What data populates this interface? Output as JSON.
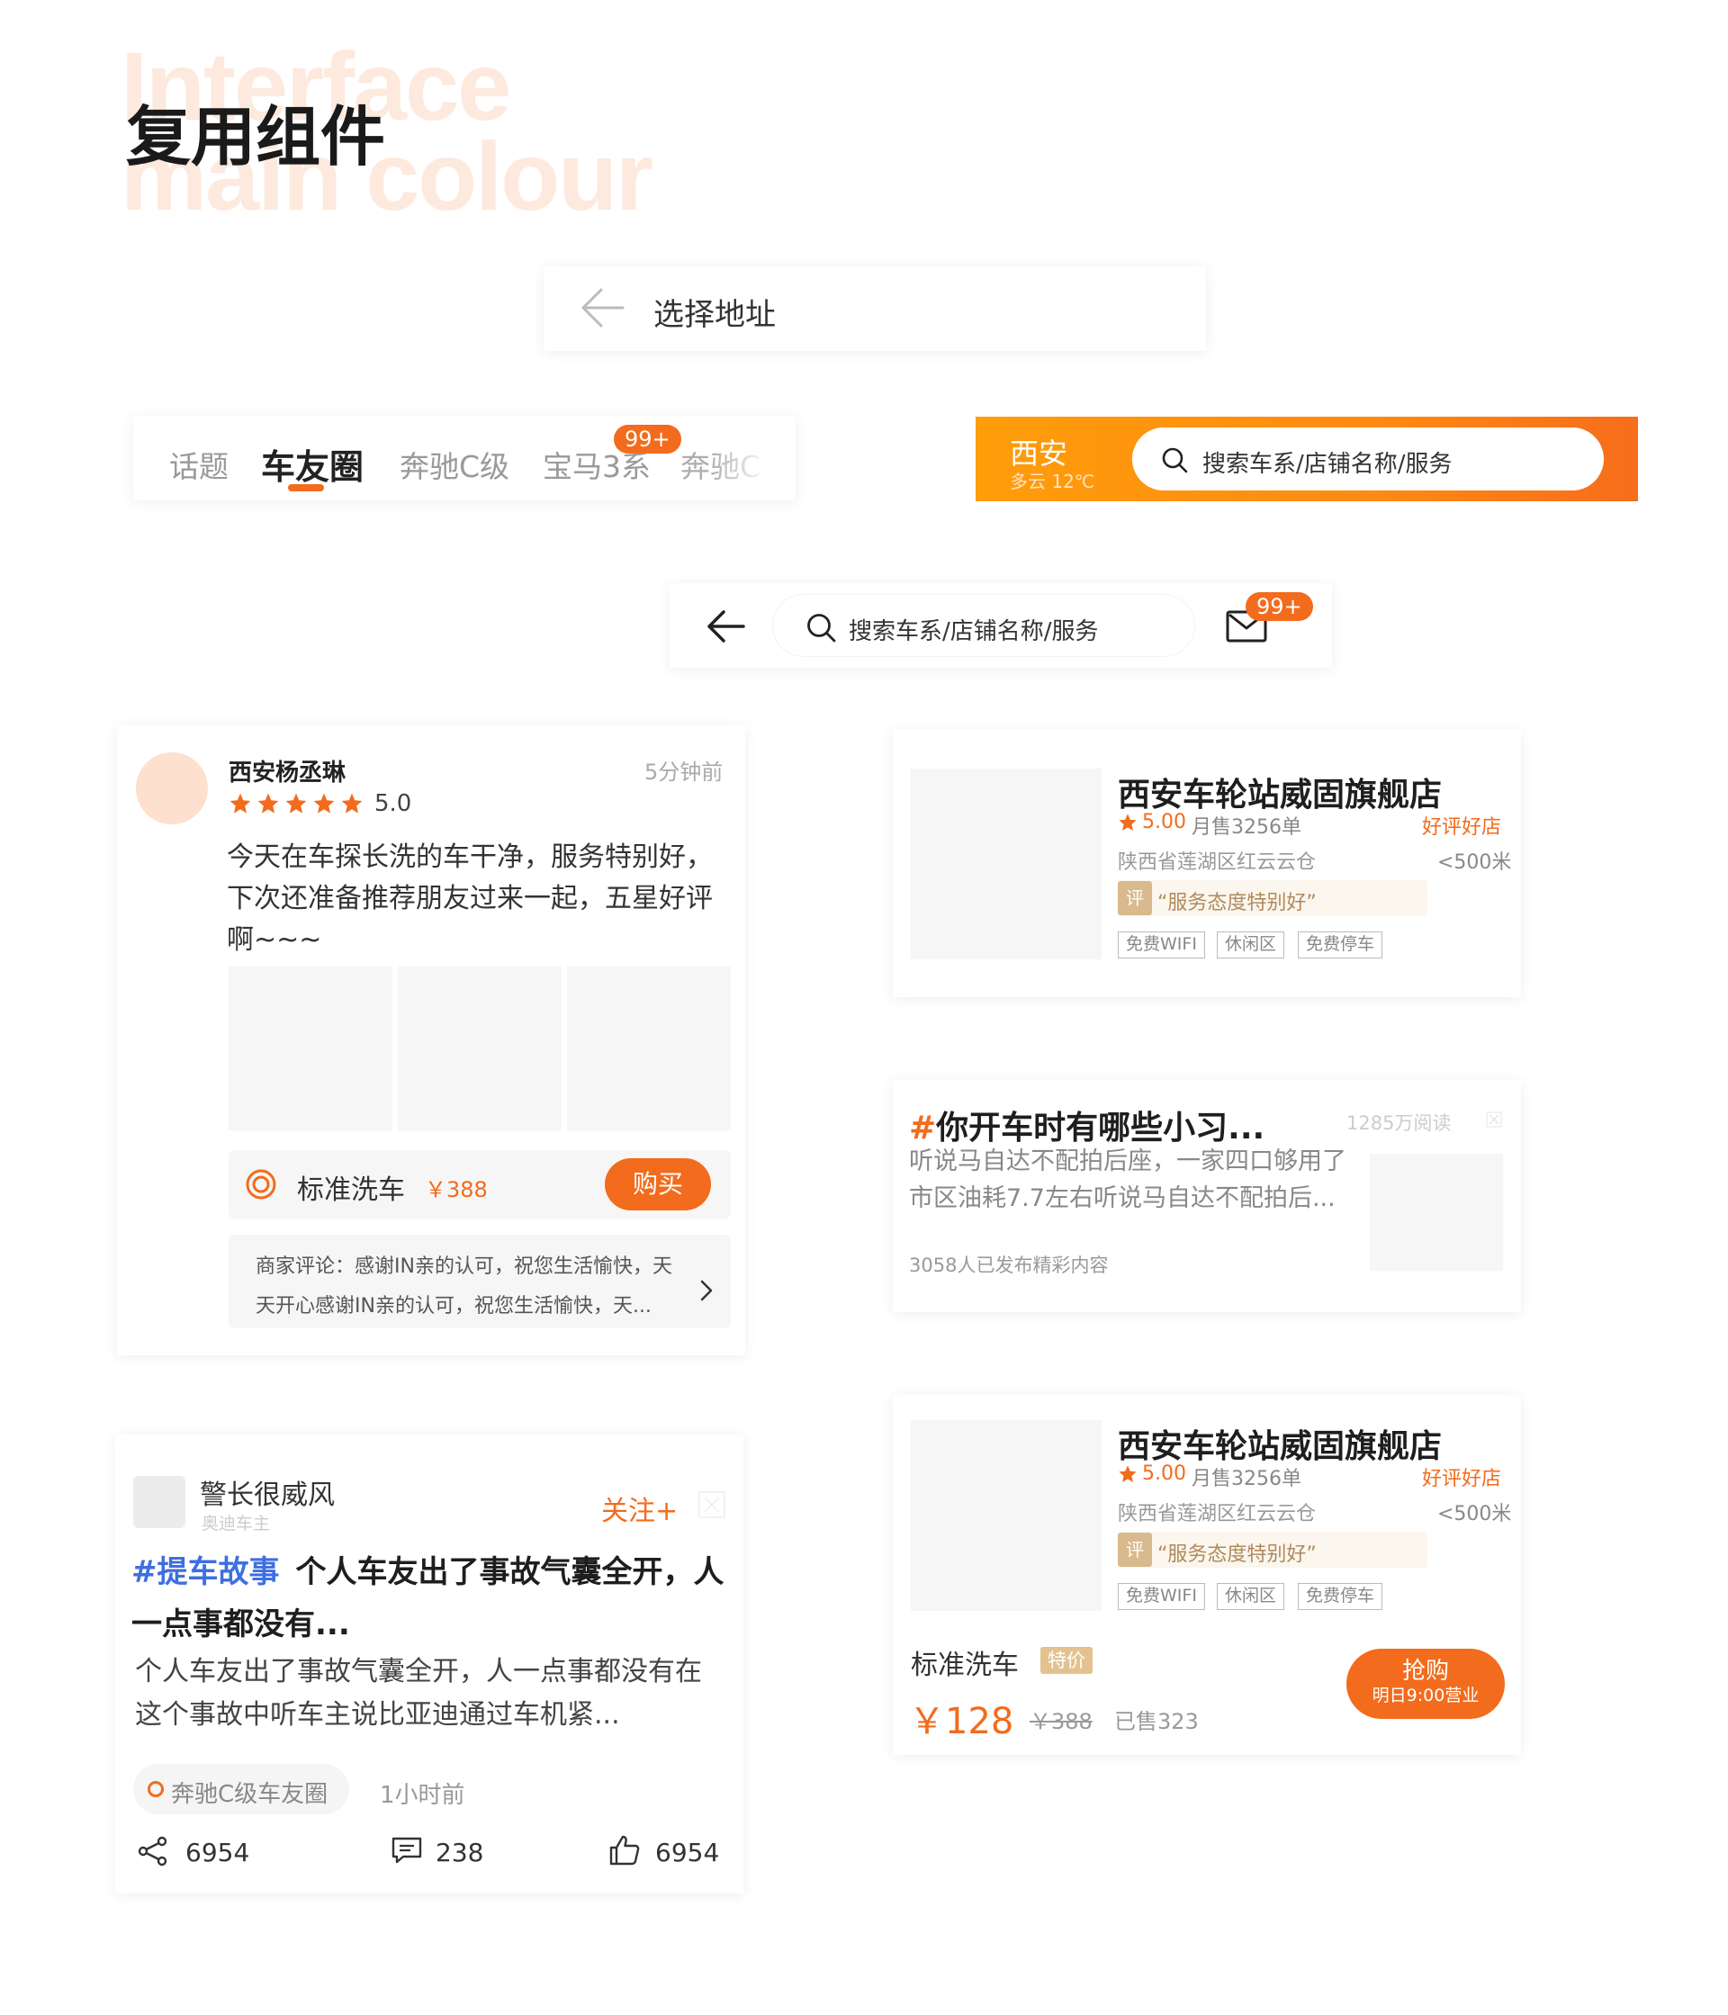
{
  "header": {
    "bg_line1": "Interface",
    "bg_line2": "main colour",
    "title": "复用组件"
  },
  "nav_address": {
    "title": "选择地址"
  },
  "tabs": {
    "items": [
      "话题",
      "车友圈",
      "奔驰C级",
      "宝马3系",
      "奔驰C"
    ],
    "active_index": 1,
    "badge": "99+"
  },
  "orange_header": {
    "city": "西安",
    "weather": "多云 12℃",
    "search_placeholder": "搜索车系/店铺名称/服务"
  },
  "search_bar": {
    "placeholder": "搜索车系/店铺名称/服务",
    "badge": "99+"
  },
  "review": {
    "user": "西安杨丞琳",
    "time": "5分钟前",
    "rating": "5.0",
    "stars": 5,
    "content": "今天在车探长洗的车干净，服务特别好，下次还准备推荐朋友过来一起，五星好评啊~~~",
    "product_name": "标准洗车",
    "product_price": "￥388",
    "buy_label": "购买",
    "merchant_reply": "商家评论：感谢IN亲的认可，祝您生活愉快，天天开心感谢IN亲的认可，祝您生活愉快，天..."
  },
  "shop1": {
    "name": "西安车轮站威固旗舰店",
    "rating": "5.00",
    "monthly_sales": "月售3256单",
    "badge": "好评好店",
    "address": "陕西省莲湖区红云云仓",
    "distance": "<500米",
    "quote_icon": "评",
    "quote": "“服务态度特别好”",
    "tags": [
      "免费WIFI",
      "休闲区",
      "免费停车"
    ]
  },
  "topic": {
    "hash": "#",
    "title": "你开车时有哪些小习...",
    "reads": "1285万阅读",
    "content": "听说马自达不配拍后座，一家四口够用了市区油耗7.7左右听说马自达不配拍后...",
    "participants": "3058人已发布精彩内容"
  },
  "shop2": {
    "name": "西安车轮站威固旗舰店",
    "rating": "5.00",
    "monthly_sales": "月售3256单",
    "badge": "好评好店",
    "address": "陕西省莲湖区红云云仓",
    "distance": "<500米",
    "quote_icon": "评",
    "quote": "“服务态度特别好”",
    "tags": [
      "免费WIFI",
      "休闲区",
      "免费停车"
    ],
    "deal_name": "标准洗车",
    "deal_tag": "特价",
    "price": "￥128",
    "original_price": "￥388",
    "sold": "已售323",
    "btn_label": "抢购",
    "btn_sub": "明日9:00营业"
  },
  "post": {
    "user": "警长很威风",
    "user_sub": "奥迪车主",
    "follow": "关注+",
    "hashtag": "#提车故事",
    "title_rest": "个人车友出了事故气囊全开，人一点事都没有...",
    "content": "个人车友出了事故气囊全开，人一点事都没有在这个事故中听车主说比亚迪通过车机紧...",
    "circle": "奔驰C级车友圈",
    "time": "1小时前",
    "shares": "6954",
    "comments": "238",
    "likes": "6954"
  },
  "colors": {
    "accent": "#f36b1c",
    "gold": "#d9b98e",
    "link": "#3e6fe0"
  }
}
